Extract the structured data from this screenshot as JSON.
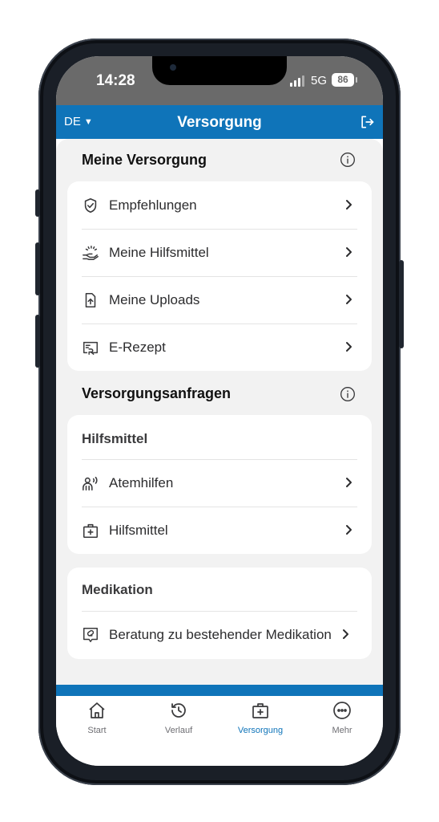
{
  "status_bar": {
    "time": "14:28",
    "network": "5G",
    "battery": "86"
  },
  "header": {
    "language": "DE",
    "title": "Versorgung"
  },
  "sections": {
    "meine_versorgung": {
      "title": "Meine Versorgung",
      "items": [
        {
          "label": "Empfehlungen",
          "icon": "shield-check-icon"
        },
        {
          "label": "Meine Hilfsmittel",
          "icon": "hand-sparkle-icon"
        },
        {
          "label": "Meine Uploads",
          "icon": "file-upload-icon"
        },
        {
          "label": "E-Rezept",
          "icon": "prescription-icon"
        }
      ]
    },
    "versorgungsanfragen": {
      "title": "Versorgungsanfragen",
      "hilfsmittel": {
        "title": "Hilfsmittel",
        "items": [
          {
            "label": "Atemhilfen",
            "icon": "person-breathing-icon"
          },
          {
            "label": "Hilfsmittel",
            "icon": "medical-bag-icon"
          }
        ]
      },
      "medikation": {
        "title": "Medikation",
        "items": [
          {
            "label": "Beratung zu bestehender Medikation",
            "icon": "pill-chat-icon"
          }
        ]
      }
    }
  },
  "tabbar": [
    {
      "label": "Start",
      "icon": "home-icon",
      "active": false
    },
    {
      "label": "Verlauf",
      "icon": "history-icon",
      "active": false
    },
    {
      "label": "Versorgung",
      "icon": "medical-bag-icon",
      "active": true
    },
    {
      "label": "Mehr",
      "icon": "more-icon",
      "active": false
    }
  ],
  "colors": {
    "primary": "#0f74b9",
    "background": "#f2f2f2",
    "status_bar": "#6a6a6a"
  }
}
